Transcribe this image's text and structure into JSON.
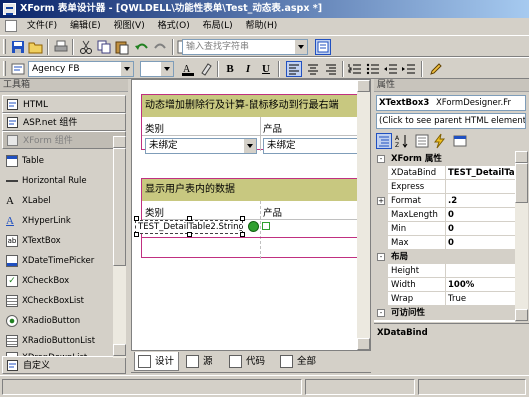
{
  "titlebar": {
    "title": "XForm 表单设计器 - [QWLDELL\\功能性表单\\Test_动态表.aspx *]"
  },
  "menu": {
    "items": [
      "文件(F)",
      "编辑(E)",
      "视图(V)",
      "格式(O)",
      "布局(L)",
      "帮助(H)"
    ]
  },
  "toolbar1": {
    "search_placeholder": "输入查找字符串"
  },
  "toolbar2": {
    "font": "Agency FB",
    "font_size": "",
    "bold": "B",
    "italic": "I",
    "underline": "U"
  },
  "toolbox": {
    "header": "工具箱",
    "categories": [
      "HTML",
      "ASP.net 组件",
      "XForm 组件",
      "自定义"
    ],
    "items": [
      "Table",
      "Horizontal Rule",
      "XLabel",
      "XHyperLink",
      "XTextBox",
      "XDateTimePicker",
      "XCheckBox",
      "XCheckBoxList",
      "XRadioButton",
      "XRadioButtonList",
      "XDropDownList"
    ]
  },
  "designer": {
    "table1": {
      "title": "动态增加删除行及计算-鼠标移动到行最右端",
      "col1": "类别",
      "col2": "产品",
      "select1": "未绑定",
      "select2": "未绑定"
    },
    "table2": {
      "title": "显示用户表内的数据",
      "col1": "类别",
      "col2": "产品",
      "textbox": "TEST_DetailTable2.String1"
    },
    "tabs": [
      "设计",
      "源",
      "代码",
      "全部"
    ]
  },
  "properties": {
    "header": "属性",
    "object_name": "XTextBox3",
    "object_type": "XFormDesigner.Fr",
    "parent_link": "(Click to see parent HTML element)",
    "rows": [
      {
        "kind": "cat",
        "name": "XForm 属性",
        "sign": "-"
      },
      {
        "kind": "prop",
        "name": "XDataBind",
        "value": "TEST_DetailTa",
        "bold": true
      },
      {
        "kind": "prop",
        "name": "Express",
        "value": ""
      },
      {
        "kind": "prop",
        "name": "Format",
        "value": ".2",
        "bold": true,
        "expand": "+"
      },
      {
        "kind": "prop",
        "name": "MaxLength",
        "value": "0",
        "bold": true
      },
      {
        "kind": "prop",
        "name": "Min",
        "value": "0",
        "bold": true
      },
      {
        "kind": "prop",
        "name": "Max",
        "value": "0",
        "bold": true
      },
      {
        "kind": "cat",
        "name": "布局",
        "sign": "-"
      },
      {
        "kind": "prop",
        "name": "Height",
        "value": ""
      },
      {
        "kind": "prop",
        "name": "Width",
        "value": "100%",
        "bold": true
      },
      {
        "kind": "prop",
        "name": "Wrap",
        "value": "True"
      },
      {
        "kind": "cat",
        "name": "可访问性",
        "sign": "-"
      }
    ],
    "description": "XDataBind"
  },
  "colors": {
    "title_start": "#0a246a",
    "title_end": "#a6caf0",
    "table_header": "#c8c880",
    "table_border": "#c03080"
  }
}
